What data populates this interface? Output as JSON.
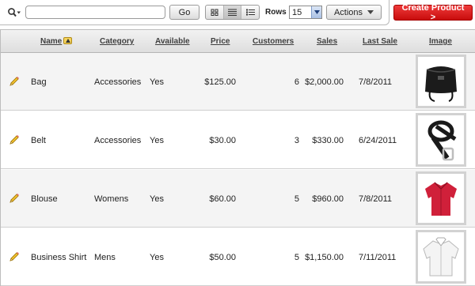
{
  "toolbar": {
    "search_value": "",
    "go_label": "Go",
    "rows_label": "Rows",
    "rows_value": "15",
    "actions_label": "Actions",
    "create_label": "Create Product >",
    "icons": [
      "search-icon",
      "icon-view-icon",
      "report-view-icon",
      "detail-view-icon",
      "chevron-down-icon"
    ]
  },
  "table": {
    "headers": {
      "name": "Name",
      "category": "Category",
      "available": "Available",
      "price": "Price",
      "customers": "Customers",
      "sales": "Sales",
      "last_sale": "Last Sale",
      "image": "Image"
    },
    "sorted_by": "Name",
    "rows": [
      {
        "name": "Bag",
        "category": "Accessories",
        "available": "Yes",
        "price": "$125.00",
        "customers": "6",
        "sales": "$2,000.00",
        "last_sale": "7/8/2011",
        "image": "bag-image"
      },
      {
        "name": "Belt",
        "category": "Accessories",
        "available": "Yes",
        "price": "$30.00",
        "customers": "3",
        "sales": "$330.00",
        "last_sale": "6/24/2011",
        "image": "belt-image"
      },
      {
        "name": "Blouse",
        "category": "Womens",
        "available": "Yes",
        "price": "$60.00",
        "customers": "5",
        "sales": "$960.00",
        "last_sale": "7/8/2011",
        "image": "blouse-image"
      },
      {
        "name": "Business Shirt",
        "category": "Mens",
        "available": "Yes",
        "price": "$50.00",
        "customers": "5",
        "sales": "$1,150.00",
        "last_sale": "7/11/2011",
        "image": "shirt-image"
      }
    ]
  },
  "colors": {
    "create_button": "#d50f0f",
    "header_bg": "#e6e6e6",
    "odd_row": "#f4f4f4"
  }
}
